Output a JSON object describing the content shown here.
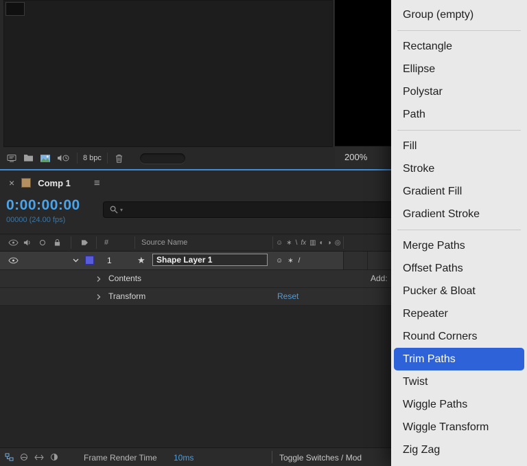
{
  "colors": {
    "focus_accent": "#3e8edc",
    "timecode_blue": "#4da3e8",
    "link_blue": "#4f9ddc",
    "menu_highlight": "#2e62d8",
    "label_swatch": "#585cd8",
    "comp_swatch": "#b3905f"
  },
  "top": {
    "bpc_label": "8 bpc",
    "zoom_label": "200%"
  },
  "icons": {
    "close": "×",
    "panel_menu": "≡",
    "star": "★",
    "search_caret": "▾",
    "shy": "☺",
    "collapse": "∗",
    "quality_draft": "\\",
    "quality_best": "/",
    "fx": "fx",
    "frame_blend": "▥",
    "motion_blur": "◐",
    "adjustment": "◑",
    "three_d": "◎"
  },
  "timeline": {
    "tab_label": "Comp 1",
    "timecode": "0:00:00:00",
    "timecode_sub": "00000 (24.00 fps)",
    "columns": {
      "hash": "#",
      "source_name": "Source Name"
    },
    "layer": {
      "index": "1",
      "name": "Shape Layer 1"
    },
    "contents_label": "Contents",
    "add_label": "Add:",
    "transform_label": "Transform",
    "reset_label": "Reset",
    "status": {
      "frame_render_label": "Frame Render Time",
      "frame_render_value": "10ms",
      "toggle_label": "Toggle Switches / Mod"
    }
  },
  "context_menu": {
    "items": [
      {
        "label": "Group (empty)",
        "selected": false
      },
      {
        "label": "Rectangle",
        "selected": false
      },
      {
        "label": "Ellipse",
        "selected": false
      },
      {
        "label": "Polystar",
        "selected": false
      },
      {
        "label": "Path",
        "selected": false
      },
      {
        "label": "Fill",
        "selected": false
      },
      {
        "label": "Stroke",
        "selected": false
      },
      {
        "label": "Gradient Fill",
        "selected": false
      },
      {
        "label": "Gradient Stroke",
        "selected": false
      },
      {
        "label": "Merge Paths",
        "selected": false
      },
      {
        "label": "Offset Paths",
        "selected": false
      },
      {
        "label": "Pucker & Bloat",
        "selected": false
      },
      {
        "label": "Repeater",
        "selected": false
      },
      {
        "label": "Round Corners",
        "selected": false
      },
      {
        "label": "Trim Paths",
        "selected": true
      },
      {
        "label": "Twist",
        "selected": false
      },
      {
        "label": "Wiggle Paths",
        "selected": false
      },
      {
        "label": "Wiggle Transform",
        "selected": false
      },
      {
        "label": "Zig Zag",
        "selected": false
      }
    ]
  }
}
